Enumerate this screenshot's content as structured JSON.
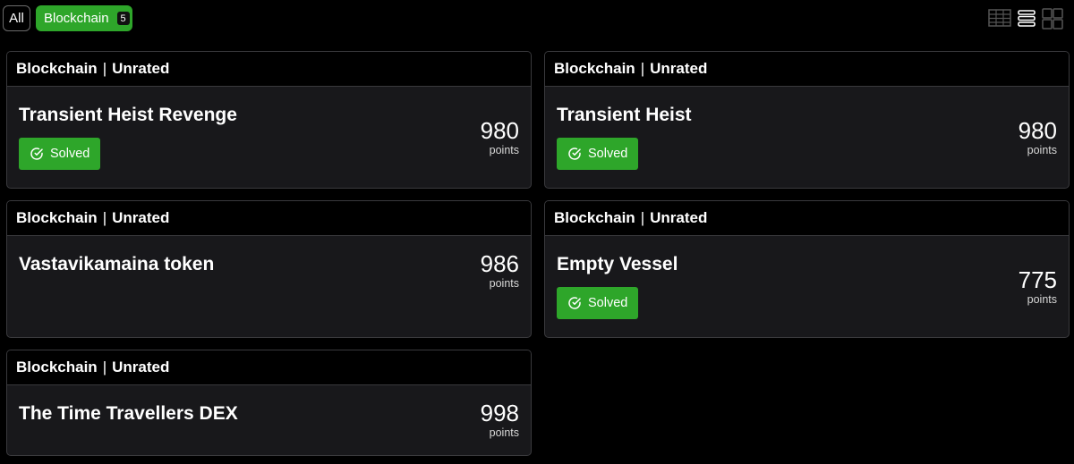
{
  "filters": {
    "all_label": "All",
    "blockchain_label": "Blockchain",
    "blockchain_count": "5"
  },
  "view_toggles": [
    "table-view-icon",
    "list-view-icon",
    "grid-view-icon"
  ],
  "points_label": "points",
  "solved_label": "Solved",
  "colors": {
    "background": "#000000",
    "card": "#18181b",
    "accent_green": "#2ea62a",
    "border": "#3a3a3d"
  },
  "challenges": [
    {
      "category": "Blockchain",
      "rating": "Unrated",
      "title": "Transient Heist Revenge",
      "points": "980",
      "solved": true
    },
    {
      "category": "Blockchain",
      "rating": "Unrated",
      "title": "Transient Heist",
      "points": "980",
      "solved": true
    },
    {
      "category": "Blockchain",
      "rating": "Unrated",
      "title": "Vastavikamaina token",
      "points": "986",
      "solved": false
    },
    {
      "category": "Blockchain",
      "rating": "Unrated",
      "title": "Empty Vessel",
      "points": "775",
      "solved": true
    },
    {
      "category": "Blockchain",
      "rating": "Unrated",
      "title": "The Time Travellers DEX",
      "points": "998",
      "solved": false
    }
  ]
}
